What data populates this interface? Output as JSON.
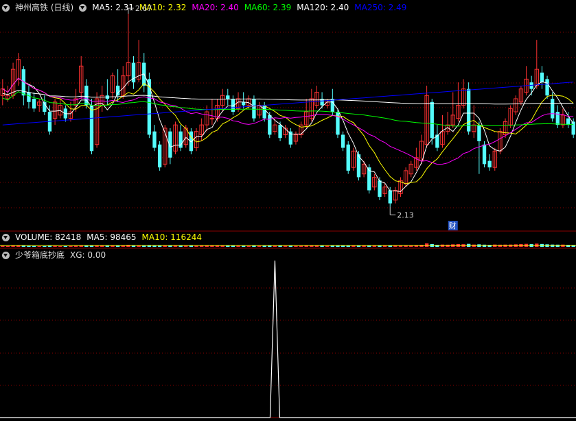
{
  "main_panel": {
    "title": "神州高铁 (日线)",
    "ma_labels": [
      {
        "text": "MA5: 2.31",
        "color": "#ffffff"
      },
      {
        "text": "MA10: 2.32",
        "color": "#ffff00"
      },
      {
        "text": "MA20: 2.40",
        "color": "#ff00ff"
      },
      {
        "text": "MA60: 2.39",
        "color": "#00ff00"
      },
      {
        "text": "MA120: 2.40",
        "color": "#ffffff"
      },
      {
        "text": "MA250: 2.49",
        "color": "#0000ff"
      }
    ],
    "high_label": "2.67",
    "low_label": "2.13",
    "badge": "财"
  },
  "volume_panel": {
    "labels": [
      {
        "text": "VOLUME: 82418",
        "color": "#ffffff"
      },
      {
        "text": "MA5: 98465",
        "color": "#ffffff"
      },
      {
        "text": "MA10: 116244",
        "color": "#ffff00"
      }
    ]
  },
  "indicator_panel": {
    "title": "少爷箱底抄底",
    "xg_label": "XG: 0.00"
  },
  "colors": {
    "up": "#ff3232",
    "down": "#54fcfc",
    "grid": "#8b0000",
    "ma5": "#ffffff",
    "ma10": "#ffff00",
    "ma20": "#ff00ff",
    "ma60": "#00ff00",
    "ma120": "#ffffff",
    "ma250": "#0000ff"
  },
  "chart_data": {
    "type": "candlestick",
    "price_range": [
      2.07,
      2.72
    ],
    "candles": [
      [
        2.47,
        2.49,
        2.44,
        2.52
      ],
      [
        2.46,
        2.47,
        2.45,
        2.5
      ],
      [
        2.47,
        2.55,
        2.46,
        2.57
      ],
      [
        2.52,
        2.58,
        2.5,
        2.6
      ],
      [
        2.55,
        2.47,
        2.44,
        2.56
      ],
      [
        2.48,
        2.45,
        2.43,
        2.5
      ],
      [
        2.46,
        2.43,
        2.42,
        2.48
      ],
      [
        2.44,
        2.45,
        2.42,
        2.46
      ],
      [
        2.45,
        2.42,
        2.41,
        2.47
      ],
      [
        2.42,
        2.36,
        2.35,
        2.44
      ],
      [
        2.4,
        2.45,
        2.38,
        2.46
      ],
      [
        2.41,
        2.44,
        2.4,
        2.46
      ],
      [
        2.43,
        2.4,
        2.39,
        2.44
      ],
      [
        2.4,
        2.42,
        2.39,
        2.45
      ],
      [
        2.44,
        2.46,
        2.42,
        2.49
      ],
      [
        2.48,
        2.56,
        2.46,
        2.59
      ],
      [
        2.5,
        2.44,
        2.43,
        2.52
      ],
      [
        2.44,
        2.3,
        2.29,
        2.46
      ],
      [
        2.32,
        2.46,
        2.31,
        2.48
      ],
      [
        2.44,
        2.47,
        2.42,
        2.5
      ],
      [
        2.47,
        2.46,
        2.44,
        2.52
      ],
      [
        2.48,
        2.53,
        2.46,
        2.54
      ],
      [
        2.5,
        2.47,
        2.45,
        2.55
      ],
      [
        2.47,
        2.53,
        2.46,
        2.56
      ],
      [
        2.53,
        2.57,
        2.5,
        2.72
      ],
      [
        2.57,
        2.51,
        2.49,
        2.59
      ],
      [
        2.52,
        2.57,
        2.51,
        2.64
      ],
      [
        2.57,
        2.5,
        2.48,
        2.6
      ],
      [
        2.52,
        2.35,
        2.34,
        2.54
      ],
      [
        2.36,
        2.31,
        2.3,
        2.38
      ],
      [
        2.32,
        2.25,
        2.24,
        2.33
      ],
      [
        2.26,
        2.37,
        2.25,
        2.38
      ],
      [
        2.36,
        2.28,
        2.26,
        2.37
      ],
      [
        2.3,
        2.38,
        2.29,
        2.39
      ],
      [
        2.36,
        2.31,
        2.3,
        2.38
      ],
      [
        2.32,
        2.37,
        2.31,
        2.38
      ],
      [
        2.36,
        2.3,
        2.29,
        2.37
      ],
      [
        2.31,
        2.36,
        2.3,
        2.37
      ],
      [
        2.35,
        2.38,
        2.33,
        2.4
      ],
      [
        2.38,
        2.42,
        2.36,
        2.44
      ],
      [
        2.4,
        2.4,
        2.38,
        2.46
      ],
      [
        2.4,
        2.44,
        2.39,
        2.46
      ],
      [
        2.44,
        2.47,
        2.42,
        2.49
      ],
      [
        2.47,
        2.46,
        2.44,
        2.49
      ],
      [
        2.46,
        2.42,
        2.41,
        2.47
      ],
      [
        2.43,
        2.46,
        2.42,
        2.48
      ],
      [
        2.45,
        2.44,
        2.43,
        2.48
      ],
      [
        2.44,
        2.46,
        2.43,
        2.47
      ],
      [
        2.46,
        2.4,
        2.39,
        2.47
      ],
      [
        2.41,
        2.44,
        2.4,
        2.45
      ],
      [
        2.44,
        2.4,
        2.39,
        2.45
      ],
      [
        2.41,
        2.35,
        2.34,
        2.42
      ],
      [
        2.36,
        2.38,
        2.35,
        2.4
      ],
      [
        2.38,
        2.34,
        2.33,
        2.39
      ],
      [
        2.35,
        2.37,
        2.34,
        2.38
      ],
      [
        2.36,
        2.32,
        2.31,
        2.37
      ],
      [
        2.33,
        2.35,
        2.32,
        2.36
      ],
      [
        2.35,
        2.38,
        2.34,
        2.39
      ],
      [
        2.38,
        2.42,
        2.37,
        2.46
      ],
      [
        2.4,
        2.46,
        2.39,
        2.49
      ],
      [
        2.44,
        2.48,
        2.43,
        2.5
      ],
      [
        2.46,
        2.44,
        2.43,
        2.48
      ],
      [
        2.44,
        2.45,
        2.43,
        2.46
      ],
      [
        2.46,
        2.42,
        2.41,
        2.49
      ],
      [
        2.42,
        2.35,
        2.34,
        2.43
      ],
      [
        2.35,
        2.31,
        2.3,
        2.36
      ],
      [
        2.32,
        2.24,
        2.23,
        2.33
      ],
      [
        2.25,
        2.3,
        2.24,
        2.31
      ],
      [
        2.29,
        2.22,
        2.21,
        2.3
      ],
      [
        2.23,
        2.26,
        2.22,
        2.27
      ],
      [
        2.25,
        2.18,
        2.17,
        2.26
      ],
      [
        2.19,
        2.22,
        2.18,
        2.23
      ],
      [
        2.21,
        2.16,
        2.15,
        2.22
      ],
      [
        2.17,
        2.19,
        2.16,
        2.2
      ],
      [
        2.18,
        2.14,
        2.13,
        2.19
      ],
      [
        2.15,
        2.18,
        2.14,
        2.19
      ],
      [
        2.17,
        2.21,
        2.16,
        2.22
      ],
      [
        2.2,
        2.24,
        2.19,
        2.25
      ],
      [
        2.23,
        2.26,
        2.22,
        2.27
      ],
      [
        2.25,
        2.28,
        2.24,
        2.31
      ],
      [
        2.27,
        2.33,
        2.26,
        2.35
      ],
      [
        2.32,
        2.47,
        2.31,
        2.5
      ],
      [
        2.45,
        2.34,
        2.32,
        2.46
      ],
      [
        2.35,
        2.31,
        2.3,
        2.38
      ],
      [
        2.32,
        2.36,
        2.31,
        2.41
      ],
      [
        2.36,
        2.38,
        2.35,
        2.42
      ],
      [
        2.38,
        2.41,
        2.37,
        2.48
      ],
      [
        2.4,
        2.44,
        2.39,
        2.51
      ],
      [
        2.44,
        2.49,
        2.43,
        2.52
      ],
      [
        2.49,
        2.36,
        2.35,
        2.51
      ],
      [
        2.36,
        2.38,
        2.34,
        2.44
      ],
      [
        2.38,
        2.33,
        2.23,
        2.39
      ],
      [
        2.32,
        2.26,
        2.25,
        2.33
      ],
      [
        2.27,
        2.25,
        2.24,
        2.29
      ],
      [
        2.25,
        2.3,
        2.24,
        2.31
      ],
      [
        2.3,
        2.36,
        2.29,
        2.37
      ],
      [
        2.35,
        2.39,
        2.34,
        2.4
      ],
      [
        2.38,
        2.43,
        2.37,
        2.44
      ],
      [
        2.42,
        2.46,
        2.41,
        2.47
      ],
      [
        2.45,
        2.49,
        2.44,
        2.5
      ],
      [
        2.48,
        2.52,
        2.47,
        2.56
      ],
      [
        2.51,
        2.49,
        2.47,
        2.53
      ],
      [
        2.5,
        2.55,
        2.49,
        2.64
      ],
      [
        2.54,
        2.51,
        2.49,
        2.56
      ],
      [
        2.52,
        2.47,
        2.46,
        2.53
      ],
      [
        2.46,
        2.4,
        2.39,
        2.48
      ],
      [
        2.42,
        2.38,
        2.37,
        2.44
      ],
      [
        2.38,
        2.41,
        2.37,
        2.43
      ],
      [
        2.4,
        2.38,
        2.37,
        2.42
      ],
      [
        2.39,
        2.35,
        2.34,
        2.4
      ]
    ],
    "volume_values": [
      40,
      35,
      50,
      60,
      45,
      38,
      36,
      30,
      34,
      42,
      38,
      30,
      32,
      35,
      40,
      55,
      48,
      62,
      58,
      46,
      44,
      50,
      52,
      48,
      90,
      70,
      75,
      68,
      80,
      60,
      52,
      56,
      48,
      50,
      44,
      42,
      46,
      40,
      44,
      50,
      46,
      48,
      52,
      50,
      44,
      42,
      40,
      38,
      44,
      40,
      42,
      46,
      40,
      44,
      40,
      42,
      38,
      40,
      46,
      52,
      50,
      44,
      40,
      46,
      60,
      58,
      66,
      56,
      62,
      50,
      64,
      52,
      60,
      48,
      62,
      56,
      60,
      66,
      70,
      80,
      90,
      150,
      120,
      90,
      100,
      95,
      110,
      120,
      115,
      130,
      100,
      110,
      96,
      90,
      100,
      95,
      98,
      100,
      110,
      120,
      130,
      118,
      140,
      125,
      110,
      100,
      96,
      98,
      90,
      82
    ],
    "xg_spike_candle_index": 52,
    "xg_values_max": 1
  }
}
